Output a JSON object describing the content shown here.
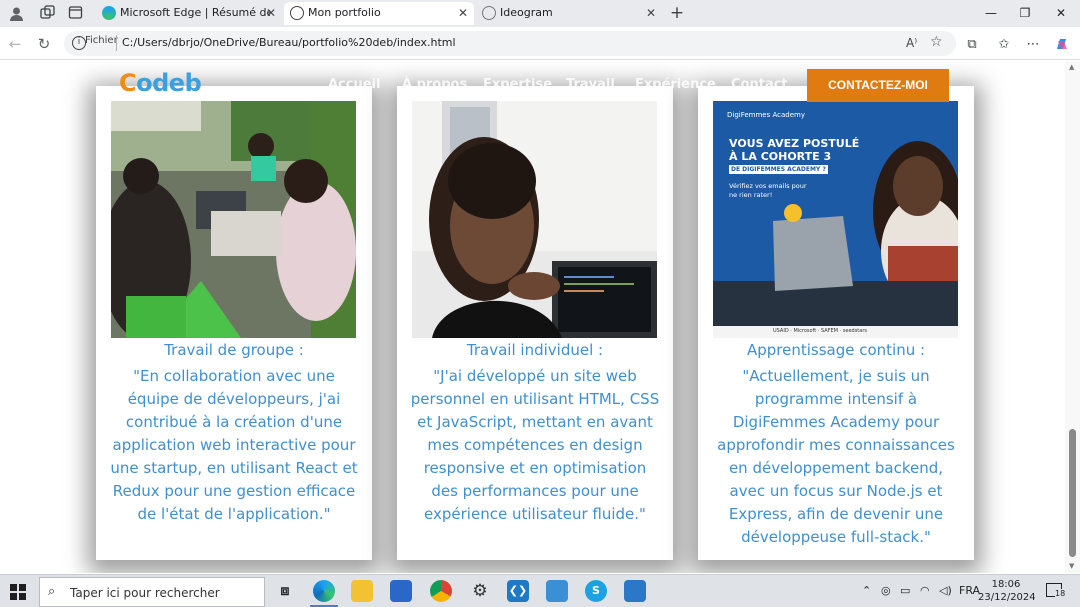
{
  "browser": {
    "tabs": [
      {
        "title": "Microsoft Edge | Résumé de l'anné",
        "active": false
      },
      {
        "title": "Mon portfolio",
        "active": true
      },
      {
        "title": "Ideogram",
        "active": false
      }
    ],
    "new_tab_label": "+",
    "address": {
      "scheme_label": "Fichier",
      "url": "C:/Users/dbrjo/OneDrive/Bureau/portfolio%20deb/index.html"
    },
    "read_aloud_label": "A⁾"
  },
  "site": {
    "logo_first": "C",
    "logo_rest": "odeb",
    "nav": [
      "Accueil",
      "À propos",
      "Expertise",
      "Travail",
      "Expérience",
      "Contact"
    ],
    "cta_label": "CONTACTEZ-MOI",
    "colors": {
      "accent": "#e07b12",
      "text_blue": "#3f8fd1",
      "logo_blue": "#3aa0e0",
      "logo_orange": "#f28a17"
    },
    "cards": [
      {
        "title": "Travail de groupe :",
        "text": "\"En collaboration avec une équipe de développeurs, j'ai contribué à la création d'une application web interactive pour une startup, en utilisant React et Redux pour une gestion efficace de l'état de l'application.\""
      },
      {
        "title": "Travail individuel :",
        "text": "\"J'ai développé un site web personnel en utilisant HTML, CSS et JavaScript, mettant en avant mes compétences en design responsive et en optimisation des performances pour une expérience utilisateur fluide.\""
      },
      {
        "title": "Apprentissage continu :",
        "text": "\"Actuellement, je suis un programme intensif à DigiFemmes Academy pour approfondir mes connaissances en développement backend, avec un focus sur Node.js et Express, afin de devenir une développeuse full-stack.\""
      }
    ],
    "poster": {
      "brand": "DigiFemmes Academy",
      "headline_1": "VOUS AVEZ POSTULÉ",
      "headline_2": "À LA COHORTE 3",
      "headline_3": "DE DIGIFEMMES ACADEMY ?",
      "sub_1": "Vérifiez vos emails pour",
      "sub_2": "ne rien rater!",
      "sponsors": "USAID · Microsoft · SAFEM · seedstars"
    }
  },
  "taskbar": {
    "search_placeholder": "Taper ici pour rechercher",
    "language": "FRA",
    "time": "18:06",
    "date": "23/12/2024",
    "notification_count": "18"
  }
}
